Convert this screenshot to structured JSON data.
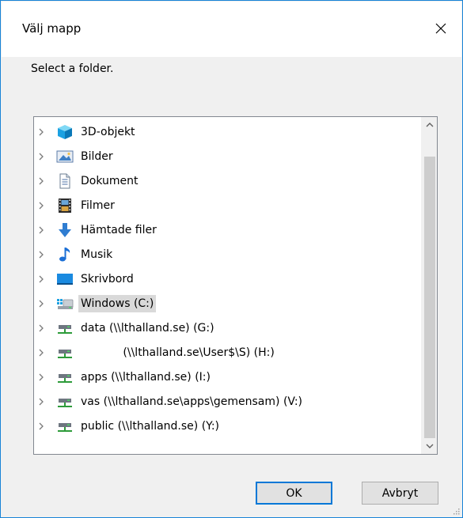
{
  "dialog": {
    "title": "Välj mapp",
    "instruction": "Select a folder.",
    "buttons": {
      "ok": "OK",
      "cancel": "Avbryt"
    }
  },
  "tree": {
    "items": [
      {
        "label": "3D-objekt",
        "icon": "3d-objects-icon"
      },
      {
        "label": "Bilder",
        "icon": "pictures-icon"
      },
      {
        "label": "Dokument",
        "icon": "documents-icon"
      },
      {
        "label": "Filmer",
        "icon": "videos-icon"
      },
      {
        "label": "Hämtade filer",
        "icon": "downloads-icon"
      },
      {
        "label": "Musik",
        "icon": "music-icon"
      },
      {
        "label": "Skrivbord",
        "icon": "desktop-icon"
      },
      {
        "label": "Windows (C:)",
        "icon": "windows-drive-icon",
        "selected": true
      },
      {
        "label": "data (\\\\lthalland.se) (G:)",
        "icon": "network-drive-icon"
      },
      {
        "label": "            (\\\\lthalland.se\\User$\\S) (H:)",
        "icon": "network-drive-icon"
      },
      {
        "label": "apps (\\\\lthalland.se) (I:)",
        "icon": "network-drive-icon"
      },
      {
        "label": "vas (\\\\lthalland.se\\apps\\gemensam) (V:)",
        "icon": "network-drive-icon"
      },
      {
        "label": "public (\\\\lthalland.se) (Y:)",
        "icon": "network-drive-icon"
      }
    ]
  },
  "colors": {
    "accent": "#0078d7",
    "selection": "#d9d9d9"
  }
}
